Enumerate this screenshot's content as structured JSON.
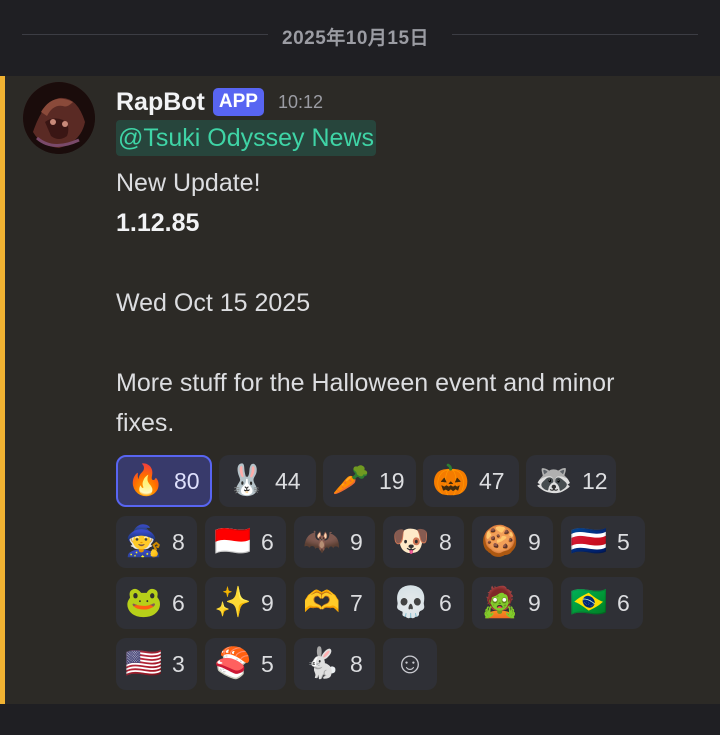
{
  "date_divider": {
    "label": "2025年10月15日"
  },
  "message": {
    "author": "RapBot",
    "badge": "APP",
    "time": "10:12",
    "mention": "@Tsuki Odyssey News",
    "lines": {
      "line1": "New Update!",
      "version": "1.12.85",
      "date": "Wed Oct 15 2025",
      "desc1": "More stuff for the Halloween event and minor",
      "desc2": "fixes."
    }
  },
  "reactions": [
    {
      "emoji": "🔥",
      "count": "80",
      "name": "fire-icon",
      "active": true
    },
    {
      "emoji": "🐰",
      "count": "44",
      "name": "bunny-icon"
    },
    {
      "emoji": "🥕",
      "count": "19",
      "name": "carrot-bunny-icon"
    },
    {
      "emoji": "🎃",
      "count": "47",
      "name": "pumpkin-icon"
    },
    {
      "emoji": "🦝",
      "count": "12",
      "name": "raccoon-icon"
    },
    {
      "emoji": "🧙",
      "count": "8",
      "name": "witch-icon"
    },
    {
      "emoji": "🇮🇩",
      "count": "6",
      "name": "flag-indonesia-icon"
    },
    {
      "emoji": "🦇",
      "count": "9",
      "name": "bat-icon"
    },
    {
      "emoji": "🐶",
      "count": "8",
      "name": "dizzy-dog-icon"
    },
    {
      "emoji": "🍪",
      "count": "9",
      "name": "gingerbread-icon"
    },
    {
      "emoji": "🇨🇷",
      "count": "5",
      "name": "flag-costa-rica-icon"
    },
    {
      "emoji": "🐸",
      "count": "6",
      "name": "frog-icon"
    },
    {
      "emoji": "✨",
      "count": "9",
      "name": "sparkles-icon"
    },
    {
      "emoji": "🫶",
      "count": "7",
      "name": "heart-hands-icon"
    },
    {
      "emoji": "💀",
      "count": "6",
      "name": "skull-icon"
    },
    {
      "emoji": "🧟",
      "count": "9",
      "name": "zombie-icon"
    },
    {
      "emoji": "🇧🇷",
      "count": "6",
      "name": "flag-brazil-icon"
    },
    {
      "emoji": "🇺🇸",
      "count": "3",
      "name": "flag-usa-icon"
    },
    {
      "emoji": "🍣",
      "count": "5",
      "name": "sushi-icon"
    },
    {
      "emoji": "🐇",
      "count": "8",
      "name": "pink-bunny-icon"
    },
    {
      "emoji": "☺",
      "count": "",
      "name": "add-reaction-icon"
    }
  ]
}
